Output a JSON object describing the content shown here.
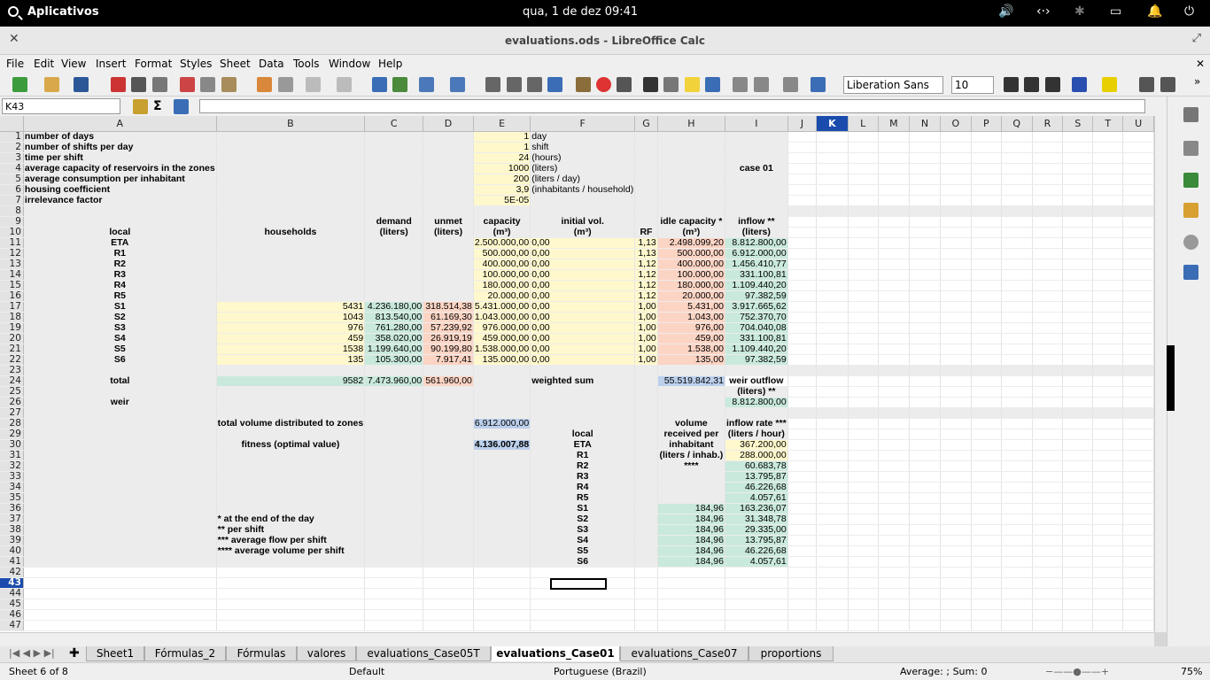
{
  "topbar": {
    "apps_label": "Aplicativos",
    "datetime": "qua,  1 de dez    09:41"
  },
  "window": {
    "title": "evaluations.ods - LibreOffice Calc"
  },
  "menu": [
    "File",
    "Edit",
    "View",
    "Insert",
    "Format",
    "Styles",
    "Sheet",
    "Data",
    "Tools",
    "Window",
    "Help"
  ],
  "toolbar": {
    "font_name": "Liberation Sans",
    "font_size": "10"
  },
  "formula_bar": {
    "name_box": "K43",
    "content": ""
  },
  "columns": [
    "A",
    "B",
    "C",
    "D",
    "E",
    "F",
    "G",
    "H",
    "I",
    "J",
    "K",
    "L",
    "M",
    "N",
    "O",
    "P",
    "Q",
    "R",
    "S",
    "T",
    "U"
  ],
  "selected_cell": "K43",
  "rows": [
    {
      "n": "1",
      "cells": {
        "A": "number of days",
        "E": "1",
        "F": "day"
      }
    },
    {
      "n": "2",
      "cells": {
        "A": "number of shifts per day",
        "E": "1",
        "F": "shift"
      }
    },
    {
      "n": "3",
      "cells": {
        "A": "time per shift",
        "E": "24",
        "F": "(hours)"
      }
    },
    {
      "n": "4",
      "cells": {
        "A": "average capacity of reservoirs in the zones",
        "E": "1000",
        "F": "(liters)",
        "I": "case 01"
      }
    },
    {
      "n": "5",
      "cells": {
        "A": "average consumption per inhabitant",
        "E": "200",
        "F": "(liters / day)"
      }
    },
    {
      "n": "6",
      "cells": {
        "A": "housing coefficient",
        "E": "3,9",
        "F": "(inhabitants / household)"
      }
    },
    {
      "n": "7",
      "cells": {
        "A": "irrelevance factor",
        "E": "5E-05"
      }
    },
    {
      "n": "8",
      "cells": {}
    },
    {
      "n": "9",
      "cells": {
        "A": "",
        "B": "",
        "C": "demand",
        "D": "unmet",
        "E": "capacity",
        "F": "initial vol.",
        "G": "",
        "H": "idle capacity *",
        "I": "inflow  **"
      }
    },
    {
      "n": "10",
      "cells": {
        "A": "local",
        "B": "households",
        "C": "(liters)",
        "D": "(liters)",
        "E": "(m³)",
        "F": "(m³)",
        "G": "RF",
        "H": "(m³)",
        "I": "(liters)"
      }
    },
    {
      "n": "11",
      "cells": {
        "A": "ETA",
        "E": "2.500.000,00",
        "F": "0,00",
        "G": "1,13",
        "H": "2.498.099,20",
        "I": "8.812.800,00"
      }
    },
    {
      "n": "12",
      "cells": {
        "A": "R1",
        "E": "500.000,00",
        "F": "0,00",
        "G": "1,13",
        "H": "500.000,00",
        "I": "6.912.000,00"
      }
    },
    {
      "n": "13",
      "cells": {
        "A": "R2",
        "E": "400.000,00",
        "F": "0,00",
        "G": "1,12",
        "H": "400.000,00",
        "I": "1.456.410,77"
      }
    },
    {
      "n": "14",
      "cells": {
        "A": "R3",
        "E": "100.000,00",
        "F": "0,00",
        "G": "1,12",
        "H": "100.000,00",
        "I": "331.100,81"
      }
    },
    {
      "n": "15",
      "cells": {
        "A": "R4",
        "E": "180.000,00",
        "F": "0,00",
        "G": "1,12",
        "H": "180.000,00",
        "I": "1.109.440,20"
      }
    },
    {
      "n": "16",
      "cells": {
        "A": "R5",
        "E": "20.000,00",
        "F": "0,00",
        "G": "1,12",
        "H": "20.000,00",
        "I": "97.382,59"
      }
    },
    {
      "n": "17",
      "cells": {
        "A": "S1",
        "B": "5431",
        "C": "4.236.180,00",
        "D": "318.514,38",
        "E": "5.431.000,00",
        "F": "0,00",
        "G": "1,00",
        "H": "5.431,00",
        "I": "3.917.665,62"
      }
    },
    {
      "n": "18",
      "cells": {
        "A": "S2",
        "B": "1043",
        "C": "813.540,00",
        "D": "61.169,30",
        "E": "1.043.000,00",
        "F": "0,00",
        "G": "1,00",
        "H": "1.043,00",
        "I": "752.370,70"
      }
    },
    {
      "n": "19",
      "cells": {
        "A": "S3",
        "B": "976",
        "C": "761.280,00",
        "D": "57.239,92",
        "E": "976.000,00",
        "F": "0,00",
        "G": "1,00",
        "H": "976,00",
        "I": "704.040,08"
      }
    },
    {
      "n": "20",
      "cells": {
        "A": "S4",
        "B": "459",
        "C": "358.020,00",
        "D": "26.919,19",
        "E": "459.000,00",
        "F": "0,00",
        "G": "1,00",
        "H": "459,00",
        "I": "331.100,81"
      }
    },
    {
      "n": "21",
      "cells": {
        "A": "S5",
        "B": "1538",
        "C": "1.199.640,00",
        "D": "90.199,80",
        "E": "1.538.000,00",
        "F": "0,00",
        "G": "1,00",
        "H": "1.538,00",
        "I": "1.109.440,20"
      }
    },
    {
      "n": "22",
      "cells": {
        "A": "S6",
        "B": "135",
        "C": "105.300,00",
        "D": "7.917,41",
        "E": "135.000,00",
        "F": "0,00",
        "G": "1,00",
        "H": "135,00",
        "I": "97.382,59"
      }
    },
    {
      "n": "23",
      "cells": {}
    },
    {
      "n": "24",
      "cells": {
        "A": "total",
        "B": "9582",
        "C": "7.473.960,00",
        "D": "561.960,00",
        "F": "weighted sum",
        "H": "55.519.842,31",
        "I": "weir outflow"
      }
    },
    {
      "n": "25",
      "cells": {
        "I": "(liters) **"
      }
    },
    {
      "n": "26",
      "cells": {
        "A": "weir",
        "I": "8.812.800,00"
      }
    },
    {
      "n": "27",
      "cells": {}
    },
    {
      "n": "28",
      "cells": {
        "B": "total volume distributed to zones",
        "E": "6.912.000,00",
        "H": "volume",
        "I": "inflow rate ***"
      }
    },
    {
      "n": "29",
      "cells": {
        "F": "local",
        "H": "received per",
        "I": "(liters / hour)"
      }
    },
    {
      "n": "30",
      "cells": {
        "B": "fitness (optimal value)",
        "E": "4.136.007,88",
        "F": "ETA",
        "H": "inhabitant",
        "I": "367.200,00"
      }
    },
    {
      "n": "31",
      "cells": {
        "F": "R1",
        "H": "(liters / inhab.)",
        "I": "288.000,00"
      }
    },
    {
      "n": "32",
      "cells": {
        "F": "R2",
        "H": "****",
        "I": "60.683,78"
      }
    },
    {
      "n": "33",
      "cells": {
        "F": "R3",
        "I": "13.795,87"
      }
    },
    {
      "n": "34",
      "cells": {
        "F": "R4",
        "I": "46.226,68"
      }
    },
    {
      "n": "35",
      "cells": {
        "F": "R5",
        "I": "4.057,61"
      }
    },
    {
      "n": "36",
      "cells": {
        "F": "S1",
        "H": "184,96",
        "I": "163.236,07"
      }
    },
    {
      "n": "37",
      "cells": {
        "B": "* at the end of the day",
        "F": "S2",
        "H": "184,96",
        "I": "31.348,78"
      }
    },
    {
      "n": "38",
      "cells": {
        "B": "** per shift",
        "F": "S3",
        "H": "184,96",
        "I": "29.335,00"
      }
    },
    {
      "n": "39",
      "cells": {
        "B": "*** average flow per shift",
        "F": "S4",
        "H": "184,96",
        "I": "13.795,87"
      }
    },
    {
      "n": "40",
      "cells": {
        "B": "**** average volume per shift",
        "F": "S5",
        "H": "184,96",
        "I": "46.226,68"
      }
    },
    {
      "n": "41",
      "cells": {
        "F": "S6",
        "H": "184,96",
        "I": "4.057,61"
      }
    },
    {
      "n": "42",
      "cells": {}
    },
    {
      "n": "43",
      "cells": {}
    },
    {
      "n": "44",
      "cells": {}
    },
    {
      "n": "45",
      "cells": {}
    },
    {
      "n": "46",
      "cells": {}
    },
    {
      "n": "47",
      "cells": {}
    }
  ],
  "sheet_tabs": [
    "Sheet1",
    "Fórmulas_2",
    "Fórmulas",
    "valores",
    "evaluations_Case05T",
    "evaluations_Case01",
    "evaluations_Case07",
    "proportions"
  ],
  "active_tab": "evaluations_Case01",
  "status": {
    "sheet": "Sheet 6 of 8",
    "style": "Default",
    "language": "Portuguese (Brazil)",
    "summary": "Average: ; Sum: 0",
    "zoom": "75%"
  }
}
